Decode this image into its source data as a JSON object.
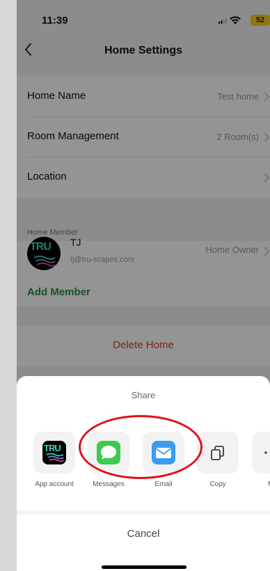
{
  "status_bar": {
    "time": "11:39",
    "battery": "52"
  },
  "header": {
    "title": "Home Settings"
  },
  "settings": {
    "home_name": {
      "label": "Home Name",
      "value": "Test home"
    },
    "room_management": {
      "label": "Room Management",
      "value": "2 Room(s)"
    },
    "location": {
      "label": "Location"
    }
  },
  "members_section": {
    "label": "Home Member",
    "member": {
      "avatar": "TRU",
      "name": "TJ",
      "email": "tj@tru-scapes.com",
      "role": "Home Owner"
    },
    "add_member": "Add Member"
  },
  "delete_home": "Delete Home",
  "share_sheet": {
    "title": "Share",
    "items": [
      {
        "label": "App account",
        "icon": "app-account-icon",
        "logo": "TRU"
      },
      {
        "label": "Messages",
        "icon": "messages-icon"
      },
      {
        "label": "Email",
        "icon": "email-icon"
      },
      {
        "label": "Copy",
        "icon": "copy-icon"
      },
      {
        "label": "Mo",
        "icon": "more-icon"
      }
    ],
    "cancel": "Cancel"
  },
  "colors": {
    "accent_green": "#2e8b3a",
    "delete_red": "#d43a2c",
    "annotation_red": "#e0101a",
    "messages_green": "#3ec94f",
    "mail_blue": "#3a9cf0"
  }
}
